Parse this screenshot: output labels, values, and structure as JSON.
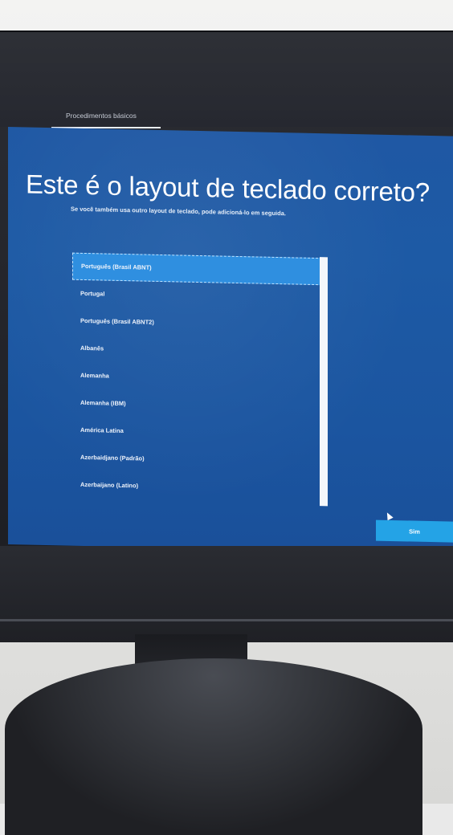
{
  "header": {
    "tab_label": "Procedimentos básicos"
  },
  "page": {
    "title": "Este é o layout de teclado correto?",
    "subtitle": "Se você também usa outro layout de teclado, pode adicioná-lo em seguida."
  },
  "layouts": {
    "selected_index": 0,
    "items": [
      "Português (Brasil ABNT)",
      "Portugal",
      "Português (Brasil ABNT2)",
      "Albanês",
      "Alemanha",
      "Alemanha (IBM)",
      "América Latina",
      "Azerbaidjano (Padrão)",
      "Azerbaijano (Latino)"
    ]
  },
  "actions": {
    "confirm_label": "Sim"
  },
  "colors": {
    "screen_blue": "#1d5aa5",
    "selection_blue": "#2f8fe0",
    "button_blue": "#24a3e6"
  }
}
